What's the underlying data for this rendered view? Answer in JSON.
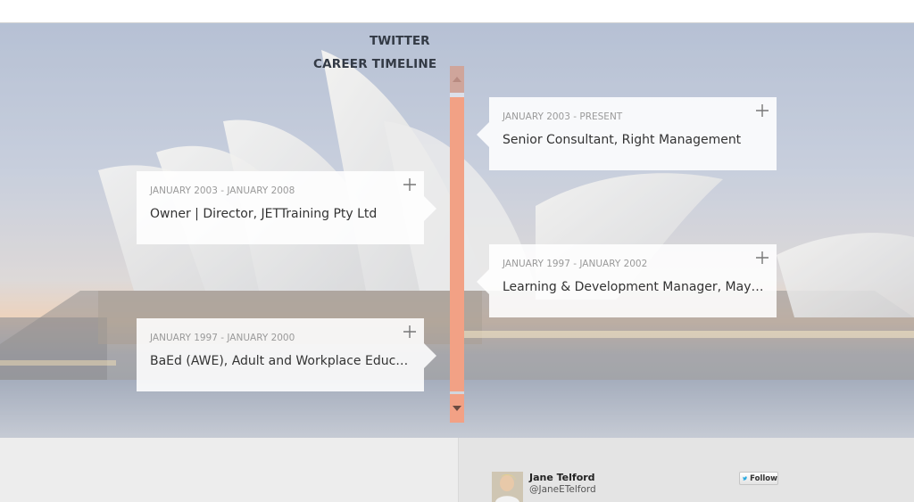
{
  "timeline": {
    "title": "CAREER TIMELINE",
    "entries": [
      {
        "date": "JANUARY 2003 - PRESENT",
        "title": "Senior Consultant, Right Management"
      },
      {
        "date": "JANUARY 2003 - JANUARY 2008",
        "title": "Owner | Director, JETTraining Pty Ltd"
      },
      {
        "date": "JANUARY 1997 - JANUARY 2002",
        "title": "Learning & Development Manager, Mayne ..."
      },
      {
        "date": "JANUARY 1997 - JANUARY 2000",
        "title": "BaEd (AWE), Adult and Workplace Educatio..."
      }
    ],
    "expand_icon": "plus-icon",
    "scroll_up_icon": "triangle-up-icon",
    "scroll_down_icon": "triangle-down-icon"
  },
  "twitter": {
    "title": "TWITTER",
    "name": "Jane Telford",
    "handle": "@JaneETelford",
    "follow_label": "Follow",
    "follow_icon": "twitter-bird-icon"
  },
  "colors": {
    "accent": "#f2a185",
    "heading": "#333a45"
  }
}
